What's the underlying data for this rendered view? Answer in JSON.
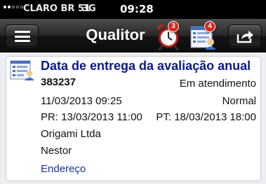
{
  "status_bar": {
    "signal_bars_on": 2,
    "signal_bars_total": 5,
    "carrier": "CLARO BR 51",
    "network": "3G",
    "time": "09:28"
  },
  "nav": {
    "title": "Qualitor",
    "alarm_badge": "3",
    "inbox_badge": "4",
    "menu_icon": "hamburger-menu-icon",
    "share_icon": "share-arrow-icon"
  },
  "ticket": {
    "title": "Data de entrega da avaliação anual",
    "id": "383237",
    "status": "Em atendimento",
    "opened": "11/03/2013 09:25",
    "priority": "Normal",
    "pr": "PR: 13/03/2013 11:00",
    "pt": "PT: 18/03/2013 18:00",
    "company": "Origami Ltda",
    "person": "Nestor",
    "address_link": "Endereço"
  },
  "colors": {
    "title_blue": "#0a1a8a",
    "link_blue": "#1a2f9c",
    "badge_red": "#d6261c",
    "background": "#eceef1"
  }
}
